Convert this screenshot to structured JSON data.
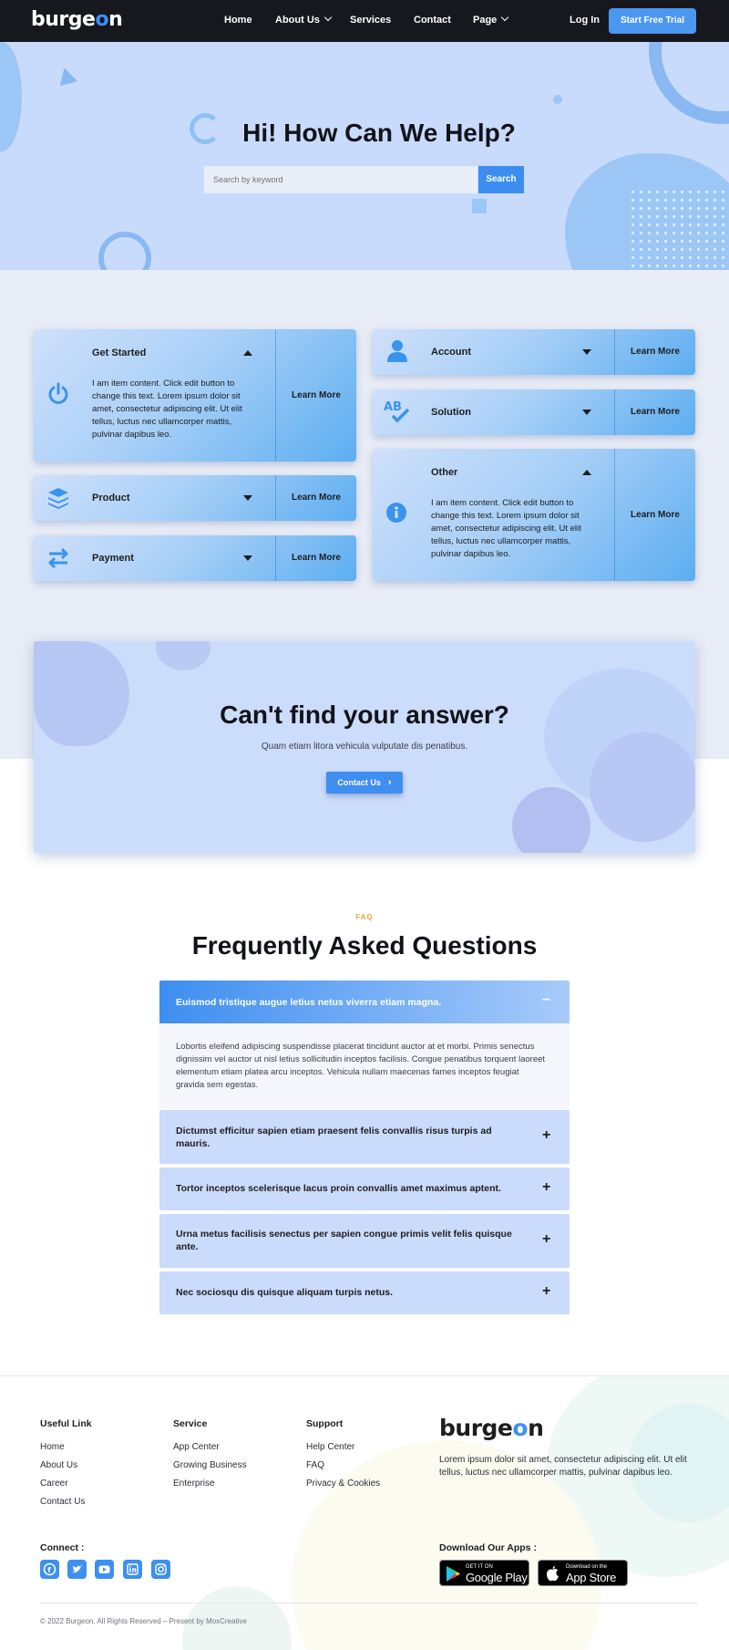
{
  "nav": {
    "logo_prefix": "burge",
    "logo_o": "o",
    "logo_suffix": "n",
    "items": [
      "Home",
      "About Us",
      "Services",
      "Contact",
      "Page"
    ],
    "login": "Log In",
    "cta": "Start Free Trial"
  },
  "hero": {
    "title": "Hi! How Can We Help?",
    "search_placeholder": "Search by keyword",
    "search_button": "Search"
  },
  "cards": [
    {
      "title": "Get Started",
      "icon": "power-icon",
      "state": "expanded",
      "body": "I am item content. Click edit button to change this text. Lorem ipsum dolor sit amet, consectetur adipiscing elit. Ut elit tellus, luctus nec ullamcorper mattis, pulvinar dapibus leo.",
      "more": "Learn More"
    },
    {
      "title": "Product",
      "icon": "layers-icon",
      "state": "collapsed",
      "more": "Learn More"
    },
    {
      "title": "Payment",
      "icon": "transfer-icon",
      "state": "collapsed",
      "more": "Learn More"
    },
    {
      "title": "Account",
      "icon": "user-icon",
      "state": "collapsed",
      "more": "Learn More"
    },
    {
      "title": "Solution",
      "icon": "spellcheck-icon",
      "state": "collapsed",
      "more": "Learn More"
    },
    {
      "title": "Other",
      "icon": "info-icon",
      "state": "expanded",
      "body": "I am item content. Click edit button to change this text. Lorem ipsum dolor sit amet, consectetur adipiscing elit. Ut elit tellus, luctus nec ullamcorper mattis, pulvinar dapibus leo.",
      "more": "Learn More"
    }
  ],
  "cta_box": {
    "title": "Can't find your answer?",
    "text": "Quam etiam litora vehicula vulputate dis penatibus.",
    "button": "Contact Us"
  },
  "faq": {
    "label": "FAQ",
    "title": "Frequently Asked Questions",
    "items": [
      {
        "q": "Euismod tristique augue letius netus viverra etiam magna.",
        "open": true,
        "a": "Lobortis eleifend adipiscing suspendisse placerat tincidunt auctor at et morbi. Primis senectus dignissim vel auctor ut nisl letius sollicitudin inceptos facilisis. Congue penatibus torquent laoreet elementum etiam platea arcu inceptos. Vehicula nullam maecenas fames inceptos feugiat gravida sem egestas."
      },
      {
        "q": "Dictumst efficitur sapien etiam praesent felis convallis risus turpis ad mauris.",
        "open": false
      },
      {
        "q": "Tortor inceptos scelerisque lacus proin convallis amet maximus aptent.",
        "open": false
      },
      {
        "q": "Urna metus facilisis senectus per sapien congue primis velit felis quisque ante.",
        "open": false
      },
      {
        "q": "Nec sociosqu dis quisque aliquam turpis netus.",
        "open": false
      }
    ]
  },
  "footer": {
    "useful": {
      "title": "Useful Link",
      "links": [
        "Home",
        "About Us",
        "Career",
        "Contact Us"
      ]
    },
    "service": {
      "title": "Service",
      "links": [
        "App Center",
        "Growing Business",
        "Enterprise"
      ]
    },
    "support": {
      "title": "Support",
      "links": [
        "Help Center",
        "FAQ",
        "Privacy & Cookies"
      ]
    },
    "logo_prefix": "burge",
    "logo_o": "o",
    "logo_suffix": "n",
    "desc": "Lorem ipsum dolor sit amet, consectetur adipiscing elit. Ut elit tellus, luctus nec ullamcorper mattis, pulvinar dapibus leo.",
    "connect": "Connect :",
    "social": [
      "facebook-icon",
      "twitter-icon",
      "youtube-icon",
      "linkedin-icon",
      "instagram-icon"
    ],
    "apps_title": "Download Our Apps :",
    "google_small": "GET IT ON",
    "google_big": "Google Play",
    "apple_small": "Download on the",
    "apple_big": "App Store",
    "copyright": "© 2022 Burgeon, All Rights Reserved – Present by MoxCreative"
  },
  "colors": {
    "accent": "#3d8ff0",
    "nav_bg": "#16181d",
    "hero_bg": "#c9dbfd",
    "faq_label": "#f0a63a"
  }
}
